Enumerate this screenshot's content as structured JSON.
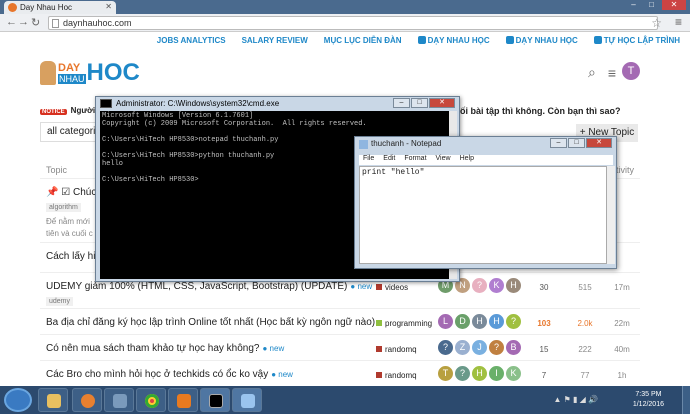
{
  "browser": {
    "tab_title": "Day Nhau Hoc",
    "url": "daynhauhoc.com"
  },
  "topnav": [
    "JOBS ANALYTICS",
    "SALARY REVIEW",
    "MỤC LỤC DIỄN ĐÀN",
    "DẠY NHAU HỌC",
    "DẠY NHAU HỌC",
    "TỰ HỌC LẬP TRÌNH"
  ],
  "logo": {
    "day": "DAY",
    "nhau": "NHAU",
    "hoc": "HOC"
  },
  "user_avatar": "T",
  "notice": {
    "badge": "NOTICE",
    "text": "Người",
    "text_right": "ối bài tập thì không. Còn bạn thì sao?"
  },
  "filter": {
    "category": "all categories",
    "new_topic": "+ New Topic"
  },
  "table_header": {
    "topic": "Topic",
    "activity": "tivity"
  },
  "topics": [
    {
      "title": "Chúc m",
      "tag": "algorithm",
      "tag2": "Để nằm mới",
      "tag3": "tiên và cuối c"
    },
    {
      "title": "Cách lấy hin"
    },
    {
      "title": "UDEMY giảm 100% (HTML, CSS, JavaScript, Bootstrap) (UPDATE)",
      "new": "● new",
      "tag": "udemy",
      "category": "videos",
      "cat_color": "#b03a2e",
      "avatars": [
        [
          "M",
          "#6f9c6a"
        ],
        [
          "N",
          "#c0a080"
        ],
        [
          "?",
          "#e8b0c0"
        ],
        [
          "K",
          "#b07ed0"
        ],
        [
          "H",
          "#9a8a7a"
        ]
      ],
      "replies": "30",
      "views": "515",
      "activity": "17m"
    },
    {
      "title": "Ba địa chỉ đăng ký học lập trình Online tốt nhất (Học bất kỳ ngôn ngữ nào)",
      "category": "programming",
      "cat_color": "#8fbf3f",
      "avatars": [
        [
          "L",
          "#a46ab3"
        ],
        [
          "D",
          "#6aa06a"
        ],
        [
          "H",
          "#7a8a9a"
        ],
        [
          "H",
          "#5a9ad8"
        ],
        [
          "?",
          "#a0c040"
        ]
      ],
      "replies": "103",
      "views": "2.0k",
      "activity": "22m"
    },
    {
      "title": "Có nên mua sách tham khảo tự học hay không?",
      "new": "● new",
      "category": "randomq",
      "cat_color": "#b03a2e",
      "avatars": [
        [
          "?",
          "#4a6a8e"
        ],
        [
          "Z",
          "#9ab0d0"
        ],
        [
          "J",
          "#7ab0e0"
        ],
        [
          "?",
          "#c08040"
        ],
        [
          "B",
          "#a46ab3"
        ]
      ],
      "replies": "15",
      "views": "222",
      "activity": "40m"
    },
    {
      "title": "Các Bro cho mình hỏi học ở techkids có ổc ko vậy",
      "new": "● new",
      "category": "randomq",
      "cat_color": "#b03a2e",
      "avatars": [
        [
          "T",
          "#b8a040"
        ],
        [
          "?",
          "#6a9a8a"
        ],
        [
          "H",
          "#a0c040"
        ],
        [
          "I",
          "#6ab06a"
        ],
        [
          "K",
          "#8ac08a"
        ]
      ],
      "replies": "7",
      "views": "77",
      "activity": "1h"
    }
  ],
  "cmd": {
    "title": "Administrator: C:\\Windows\\system32\\cmd.exe",
    "lines": [
      "Microsoft Windows [Version 6.1.7601]",
      "Copyright (c) 2009 Microsoft Corporation.  All rights reserved.",
      "",
      "C:\\Users\\HiTech HP8530>notepad thuchanh.py",
      "",
      "C:\\Users\\HiTech HP8530>python thuchanh.py",
      "hello",
      "",
      "C:\\Users\\HiTech HP8530>"
    ]
  },
  "notepad": {
    "title": "thuchanh - Notepad",
    "menu": [
      "File",
      "Edit",
      "Format",
      "View",
      "Help"
    ],
    "content": "print \"hello\""
  },
  "taskbar": {
    "time": "7:35 PM",
    "date": "1/12/2016"
  }
}
